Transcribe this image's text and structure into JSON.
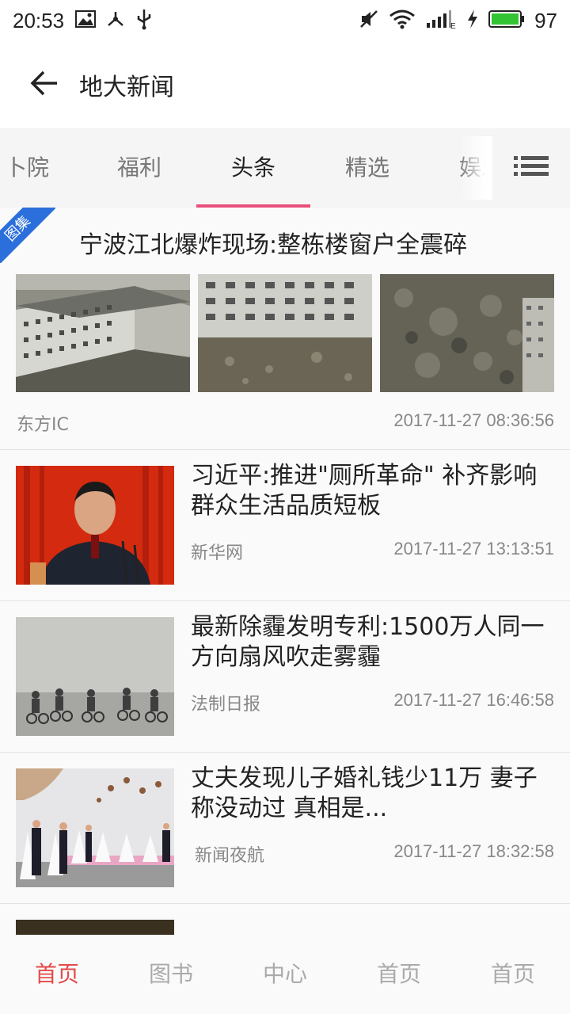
{
  "status_bar": {
    "time": "20:53",
    "battery_percent": "97",
    "icons": [
      "image-icon",
      "usb-share-icon",
      "usb-icon",
      "mute-icon",
      "wifi-icon",
      "signal-icon",
      "charging-icon",
      "battery-icon"
    ]
  },
  "app_bar": {
    "title": "地大新闻",
    "back_icon": "arrow-left-icon"
  },
  "tabs": {
    "items": [
      {
        "label": "卜院"
      },
      {
        "label": "福利"
      },
      {
        "label": "头条",
        "active": true
      },
      {
        "label": "精选"
      },
      {
        "label": "娱乐"
      }
    ],
    "menu_icon": "list-icon",
    "accent_color": "#e94f7b"
  },
  "feed": {
    "gallery": {
      "badge": "图集",
      "badge_color": "#2a6fdb",
      "title": "宁波江北爆炸现场:整栋楼窗户全震碎",
      "source": "东方IC",
      "time": "2017-11-27 08:36:56"
    },
    "items": [
      {
        "title": "习近平:推进\"厕所革命\" 补齐影响群众生活品质短板",
        "source": "新华网",
        "time": "2017-11-27 13:13:51"
      },
      {
        "title": "最新除霾发明专利:1500万人同一方向扇风吹走雾霾",
        "source": "法制日报",
        "time": "2017-11-27 16:46:58"
      },
      {
        "title": "丈夫发现儿子婚礼钱少11万 妻子称没动过 真相是...",
        "source": "新闻夜航",
        "time": "2017-11-27 18:32:58"
      }
    ]
  },
  "bottom_nav": {
    "items": [
      {
        "label": "首页",
        "active": true
      },
      {
        "label": "图书"
      },
      {
        "label": "中心"
      },
      {
        "label": "首页"
      },
      {
        "label": "首页"
      }
    ],
    "active_color": "#e34a4a"
  }
}
